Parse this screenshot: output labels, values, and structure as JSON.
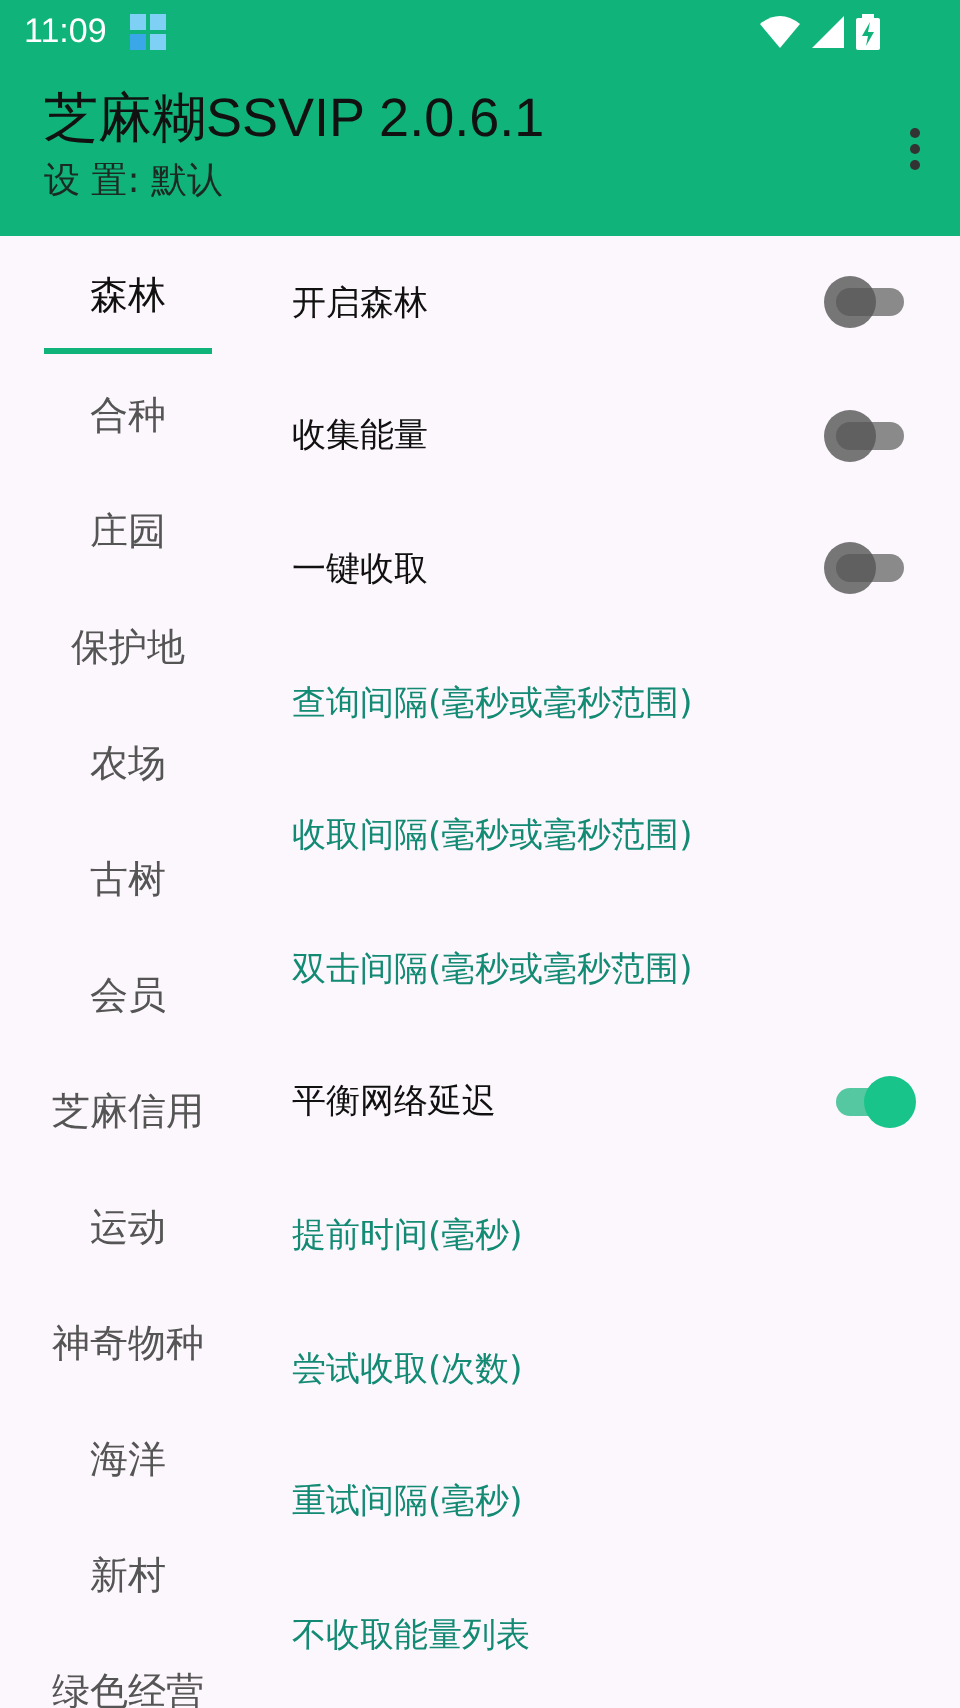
{
  "status_bar": {
    "time": "11:09"
  },
  "app_bar": {
    "title": "芝麻糊SSVIP 2.0.6.1",
    "subtitle": "设 置: 默认"
  },
  "tabs": [
    {
      "label": "森林",
      "selected": true
    },
    {
      "label": "合种",
      "selected": false
    },
    {
      "label": "庄园",
      "selected": false
    },
    {
      "label": "保护地",
      "selected": false
    },
    {
      "label": "农场",
      "selected": false
    },
    {
      "label": "古树",
      "selected": false
    },
    {
      "label": "会员",
      "selected": false
    },
    {
      "label": "芝麻信用",
      "selected": false
    },
    {
      "label": "运动",
      "selected": false
    },
    {
      "label": "神奇物种",
      "selected": false
    },
    {
      "label": "海洋",
      "selected": false
    },
    {
      "label": "新村",
      "selected": false
    },
    {
      "label": "绿色经营",
      "selected": false
    }
  ],
  "settings": [
    {
      "kind": "switch",
      "label": "开启森林",
      "on": false
    },
    {
      "kind": "switch",
      "label": "收集能量",
      "on": false
    },
    {
      "kind": "switch",
      "label": "一键收取",
      "on": false
    },
    {
      "kind": "link",
      "label": "查询间隔(毫秒或毫秒范围)"
    },
    {
      "kind": "link",
      "label": "收取间隔(毫秒或毫秒范围)"
    },
    {
      "kind": "link",
      "label": "双击间隔(毫秒或毫秒范围)"
    },
    {
      "kind": "switch",
      "label": "平衡网络延迟",
      "on": true
    },
    {
      "kind": "link",
      "label": "提前时间(毫秒)"
    },
    {
      "kind": "link",
      "label": "尝试收取(次数)"
    },
    {
      "kind": "link",
      "label": "重试间隔(毫秒)"
    },
    {
      "kind": "link",
      "label": "不收取能量列表"
    }
  ]
}
